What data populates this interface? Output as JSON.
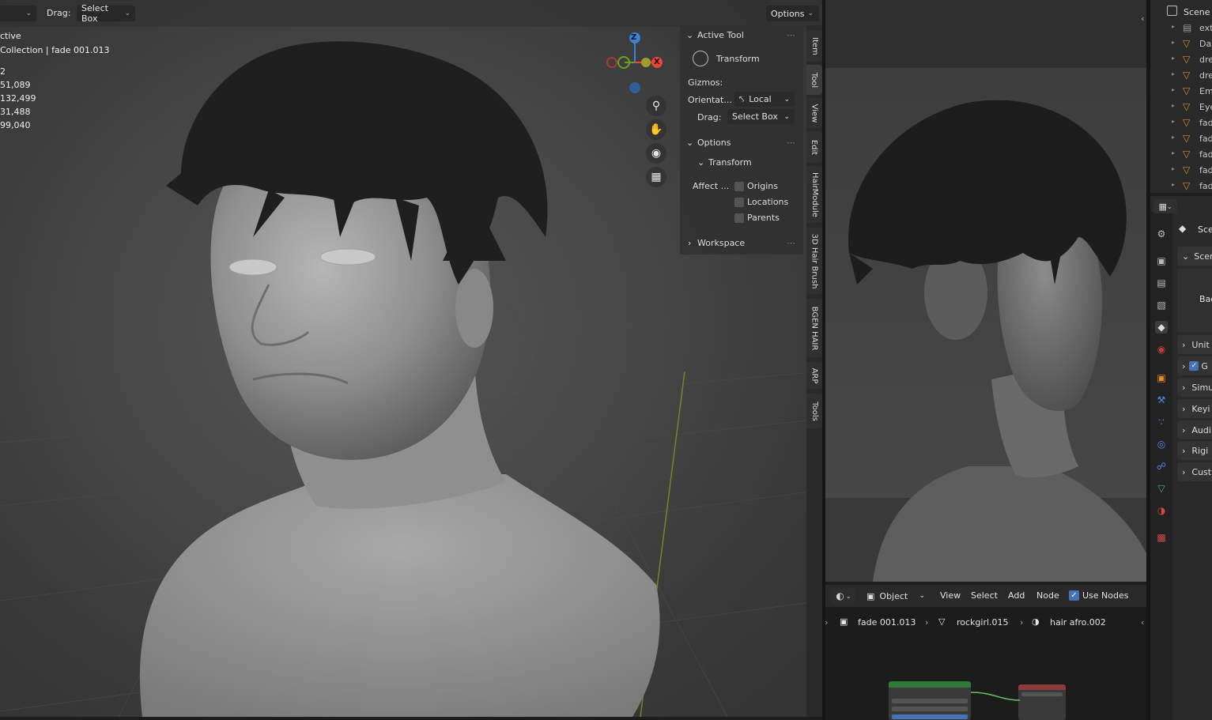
{
  "viewport": {
    "drag_label": "Drag:",
    "drag_value": "Select Box",
    "options_label": "Options",
    "stats": {
      "mode": "ctive",
      "collection": "Collection | fade 001.013",
      "line1": "2",
      "line2": "51,089",
      "line3": "132,499",
      "line4": "31,488",
      "line5": "99,040"
    },
    "gizmo_axes": {
      "z": "Z",
      "x": "X"
    }
  },
  "npanel": {
    "active_tool_header": "Active Tool",
    "tool_name": "Transform",
    "gizmos_label": "Gizmos:",
    "orientation_label": "Orientat...",
    "orientation_value": "Local",
    "drag_label": "Drag:",
    "drag_value": "Select Box",
    "options_header": "Options",
    "transform_header": "Transform",
    "affect_label": "Affect ...",
    "checkboxes": [
      "Origins",
      "Locations",
      "Parents"
    ],
    "workspace_header": "Workspace"
  },
  "vtabs": [
    "Item",
    "Tool",
    "View",
    "Edit",
    "HairModule",
    "3D Hair Brush",
    "BGEN HAIR",
    "ARP",
    "Tools"
  ],
  "node_editor": {
    "header": {
      "mode": "Object",
      "menus": [
        "View",
        "Select",
        "Add",
        "Node"
      ],
      "use_nodes": "Use Nodes"
    },
    "breadcrumb": [
      "fade 001.013",
      "rockgirl.015",
      "hair afro.002"
    ]
  },
  "outliner": {
    "title": "Scene C",
    "items": [
      "ext",
      "Daz",
      "dre",
      "dre",
      "Em",
      "Eye",
      "fad",
      "fad",
      "fad",
      "fad",
      "fad"
    ]
  },
  "properties": {
    "top": "Sce",
    "sections": [
      "Scer",
      "Backg",
      "Unit",
      "G",
      "Simu",
      "Keyi",
      "Audi",
      "Rigi",
      "Cust"
    ]
  },
  "colors": {
    "accent_blue": "#4772b3",
    "axis_x": "#e8463c",
    "axis_y": "#6ba11e",
    "axis_z": "#3a82d6",
    "node_green": "#2d7a36",
    "node_red": "#8c3a3a"
  }
}
